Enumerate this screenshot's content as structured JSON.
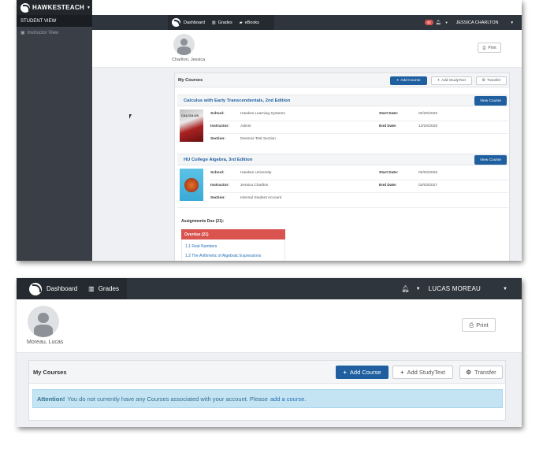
{
  "shot1": {
    "brand": "HAWKESTEACH",
    "sidebar": {
      "student_view": "STUDENT VIEW",
      "instructor_view": "Instructor View"
    },
    "nav": {
      "dashboard": "Dashboard",
      "grades": "Grades",
      "ebooks": "eBooks",
      "notification_count": "44",
      "user": "JESSICA CHARLTON"
    },
    "profile": {
      "name": "Charlton, Jessica",
      "print_label": "Print"
    },
    "courses": {
      "heading": "My Courses",
      "add_course": "Add Course",
      "add_studytext": "Add StudyText",
      "transfer": "Transfer",
      "labels": {
        "school": "School:",
        "instructor": "Instructor:",
        "section": "Section:",
        "start": "Start Date:",
        "end": "End Date:"
      },
      "view_course": "View Course",
      "items": [
        {
          "title": "Calculus with Early Transcendentals, 2nd Edition",
          "school": "Hawkes Learning Systems",
          "instructor": "Admin",
          "section": "Desmos Test Section",
          "start_date": "02/20/2026",
          "end_date": "12/20/2026"
        },
        {
          "title": "HU College Algebra, 3rd Edition",
          "school": "Hawkes University",
          "instructor": "Jessica Charlton",
          "section": "Internal Student Account",
          "start_date": "02/02/2026",
          "end_date": "02/03/2027"
        }
      ],
      "assignments_due": "Assignments Due (21):",
      "overdue": "Overdue (21)",
      "overdue_items": [
        "1.1 Real Numbers",
        "1.2 The Arithmetic of Algebraic Expressions"
      ]
    }
  },
  "shot2": {
    "nav": {
      "dashboard": "Dashboard",
      "grades": "Grades",
      "user": "LUCAS MOREAU"
    },
    "profile": {
      "name": "Moreau, Lucas",
      "print_label": "Print"
    },
    "courses": {
      "heading": "My Courses",
      "add_course": "Add Course",
      "add_studytext": "Add StudyText",
      "transfer": "Transfer"
    },
    "alert": {
      "strong": "Attention!",
      "text": "You do not currently have any Courses associated with your account. Please",
      "link": "add a course."
    }
  },
  "colors": {
    "primary": "#1f5f9f",
    "navbar": "#2f353d",
    "overdue": "#d9534f",
    "alert_bg": "#c4e3f3"
  },
  "icons": [
    "logo-icon",
    "dashboard-icon",
    "grades-icon",
    "ebooks-icon",
    "bell-icon",
    "print-icon",
    "plus-icon",
    "gear-icon",
    "chevron-down-icon",
    "instructor-icon"
  ]
}
